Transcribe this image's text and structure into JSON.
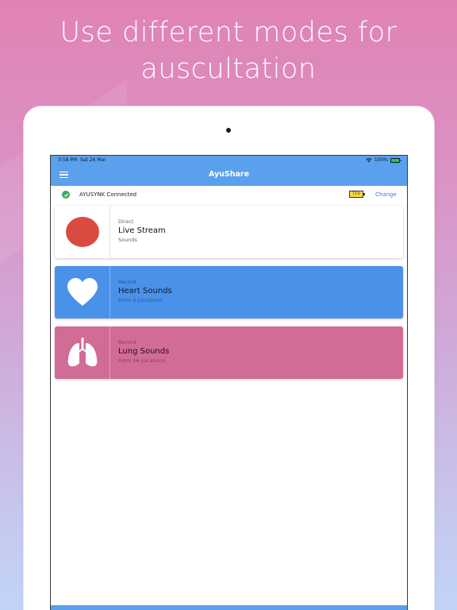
{
  "headline": {
    "line1": "Use different modes for",
    "line2": "auscultation"
  },
  "status_bar": {
    "time": "3:58 PM",
    "date": "Sat 26 Mar",
    "battery": "100%"
  },
  "app_bar": {
    "title": "AyuShare",
    "menu_icon": "hamburger-menu-icon"
  },
  "connection": {
    "status_text": "AYUSYNK Connected",
    "device_battery": "71%",
    "change_label": "Change",
    "status_color": "#3fae5b"
  },
  "modes": [
    {
      "kicker": "Direct",
      "title": "Live Stream",
      "subtitle": "Sounds",
      "icon": "record-dot-icon",
      "color": "#ffffff"
    },
    {
      "kicker": "Record",
      "title": "Heart Sounds",
      "subtitle": "From 4 Locations",
      "icon": "heart-icon",
      "color": "#4a91ea"
    },
    {
      "kicker": "Record",
      "title": "Lung Sounds",
      "subtitle": "From 16 Locations",
      "icon": "lungs-icon",
      "color": "#d16c96"
    }
  ],
  "colors": {
    "app_bar": "#5aa0ec",
    "record_dot": "#d94b40"
  }
}
